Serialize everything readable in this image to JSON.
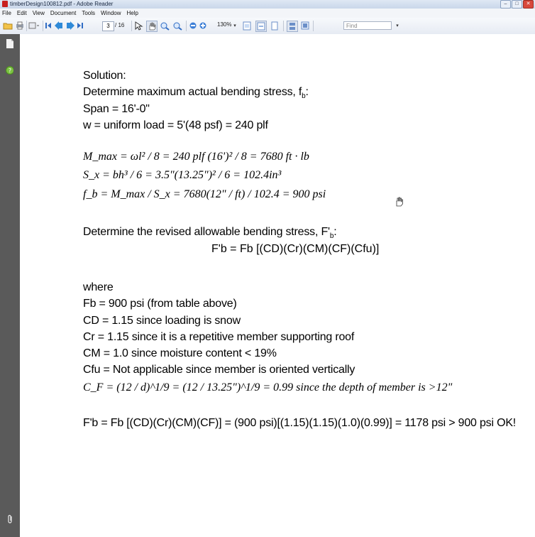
{
  "window": {
    "title": "timberDesign100812.pdf - Adobe Reader"
  },
  "menu": [
    "File",
    "Edit",
    "View",
    "Document",
    "Tools",
    "Window",
    "Help"
  ],
  "toolbar": {
    "page_current": "3",
    "page_total": "/ 16",
    "zoom": "130%",
    "find_placeholder": "Find"
  },
  "doc": {
    "l1": "Solution:",
    "l2a": "Determine maximum actual bending stress, f",
    "l2b": "b",
    "l2c": ":",
    "l3": "Span = 16'-0\"",
    "l4": "w = uniform load = 5'(48 psf) = 240 plf",
    "eq1": "M_max = ωl² / 8 = 240 plf (16')² / 8 = 7680 ft · lb",
    "eq2": "S_x = bh³ / 6 = 3.5\"(13.25\")² / 6 = 102.4in³",
    "eq3": "f_b = M_max / S_x = 7680(12\" / ft) / 102.4 = 900 psi",
    "l5a": "Determine the revised allowable bending stress, F'",
    "l5b": "b",
    "l5c": ":",
    "formula": "F'b = Fb [(CD)(Cr)(CM)(CF)(Cfu)]",
    "where": "where",
    "w1": "Fb = 900 psi (from table above)",
    "w2": "CD = 1.15 since loading is snow",
    "w3": "Cr = 1.15 since it is a repetitive member supporting roof",
    "w4": "CM = 1.0 since moisture content < 19%",
    "w5": "Cfu = Not applicable since member is oriented vertically",
    "w6": "C_F = (12 / d)^1/9 = (12 / 13.25\")^1/9 = 0.99 since the depth of member is >12\"",
    "final": "F'b = Fb [(CD)(Cr)(CM)(CF)] = (900 psi)[(1.15)(1.15)(1.0)(0.99)] = 1178 psi > 900 psi OK!"
  },
  "icons": [
    "pages-icon",
    "help-icon",
    "attachment-icon",
    "hand-cursor-icon"
  ]
}
